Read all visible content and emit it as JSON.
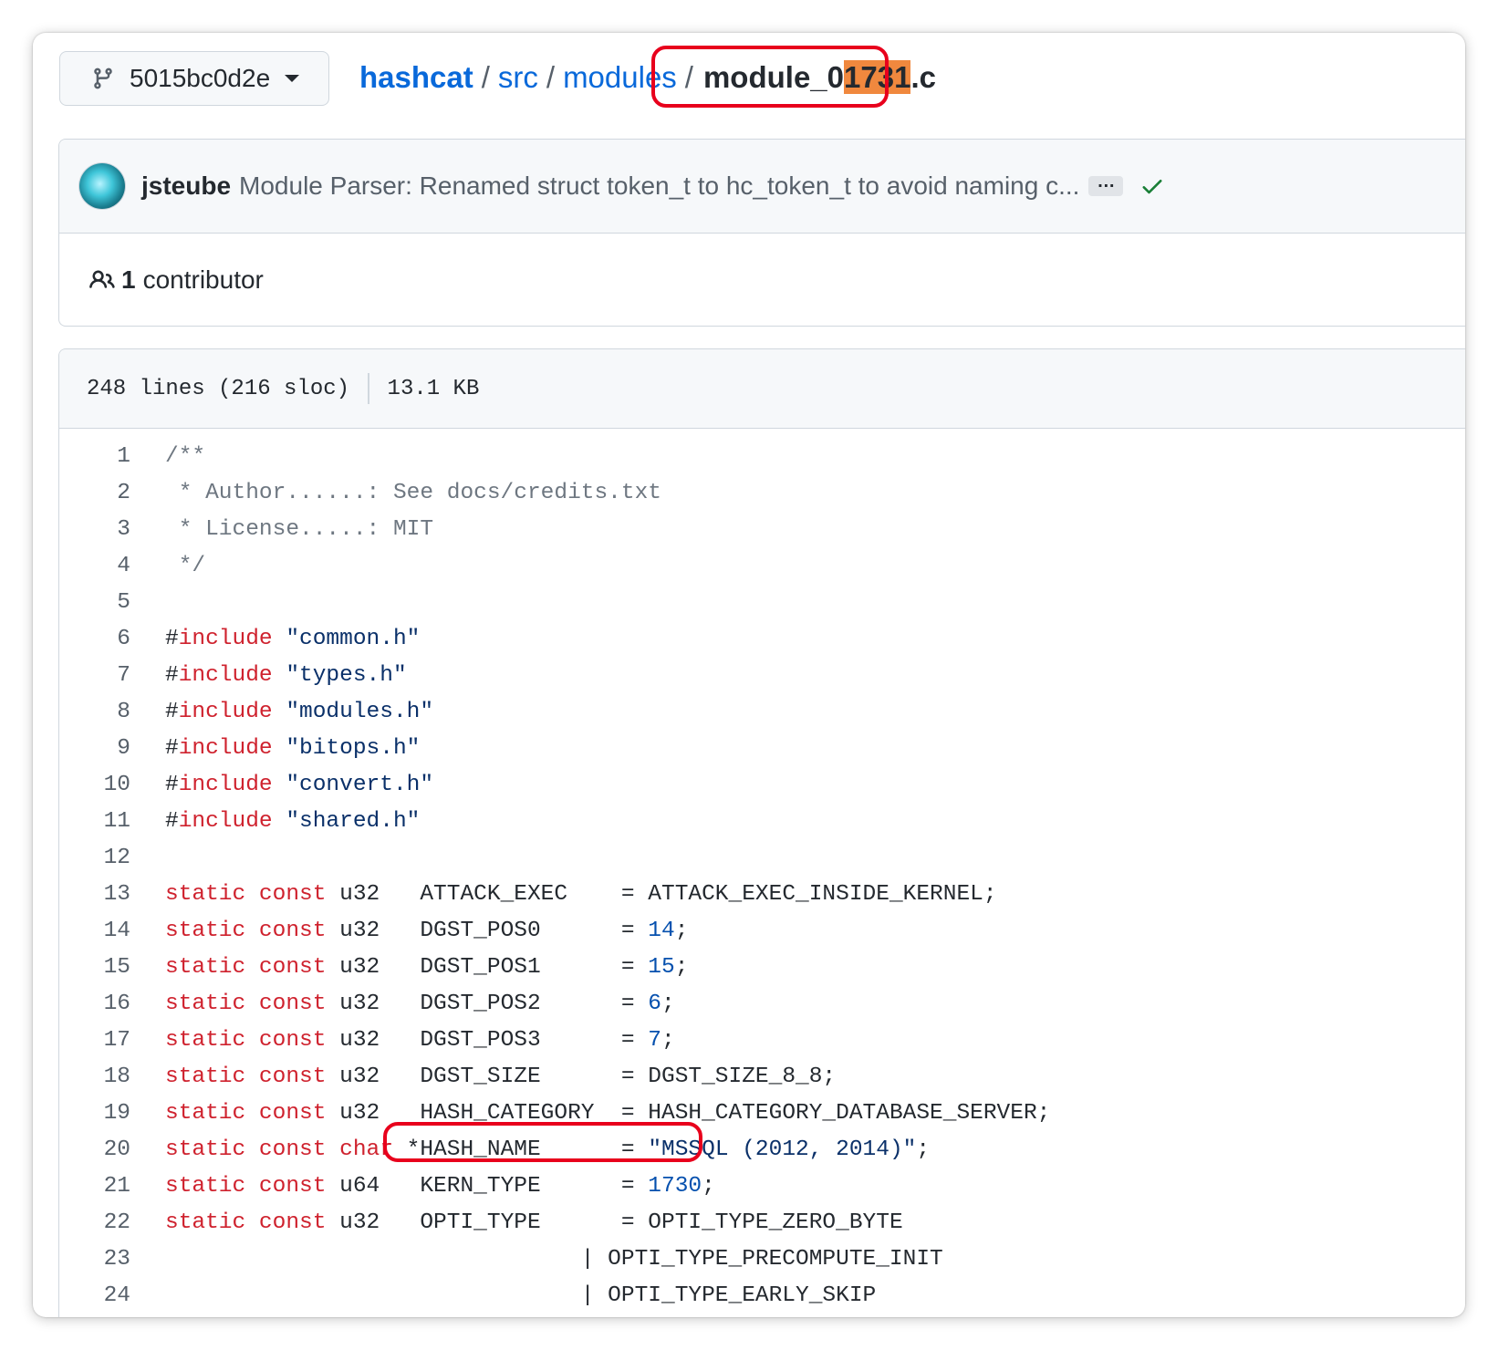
{
  "breadcrumb": {
    "branch": "5015bc0d2e",
    "repo": "hashcat",
    "path1": "src",
    "path2": "modules",
    "separator": "/",
    "file_prefix": "module_0",
    "file_highlight": "1731",
    "file_suffix": ".c"
  },
  "commit": {
    "author": "jsteube",
    "message": "Module Parser: Renamed struct token_t to hc_token_t to avoid naming c...",
    "ellipsis": "…"
  },
  "contributors": {
    "count": "1",
    "label": "contributor"
  },
  "file_info": {
    "lines": "248 lines (216 sloc)",
    "size": "13.1 KB"
  },
  "code_lines": [
    {
      "n": "1",
      "t": [
        [
          "c",
          "/**"
        ]
      ]
    },
    {
      "n": "2",
      "t": [
        [
          "c",
          " * Author......: See docs/credits.txt"
        ]
      ]
    },
    {
      "n": "3",
      "t": [
        [
          "c",
          " * License.....: MIT"
        ]
      ]
    },
    {
      "n": "4",
      "t": [
        [
          "c",
          " */"
        ]
      ]
    },
    {
      "n": "5",
      "t": []
    },
    {
      "n": "6",
      "t": [
        [
          "p",
          "#"
        ],
        [
          "k",
          "include"
        ],
        [
          "p",
          " "
        ],
        [
          "s",
          "\"common.h\""
        ]
      ]
    },
    {
      "n": "7",
      "t": [
        [
          "p",
          "#"
        ],
        [
          "k",
          "include"
        ],
        [
          "p",
          " "
        ],
        [
          "s",
          "\"types.h\""
        ]
      ]
    },
    {
      "n": "8",
      "t": [
        [
          "p",
          "#"
        ],
        [
          "k",
          "include"
        ],
        [
          "p",
          " "
        ],
        [
          "s",
          "\"modules.h\""
        ]
      ]
    },
    {
      "n": "9",
      "t": [
        [
          "p",
          "#"
        ],
        [
          "k",
          "include"
        ],
        [
          "p",
          " "
        ],
        [
          "s",
          "\"bitops.h\""
        ]
      ]
    },
    {
      "n": "10",
      "t": [
        [
          "p",
          "#"
        ],
        [
          "k",
          "include"
        ],
        [
          "p",
          " "
        ],
        [
          "s",
          "\"convert.h\""
        ]
      ]
    },
    {
      "n": "11",
      "t": [
        [
          "p",
          "#"
        ],
        [
          "k",
          "include"
        ],
        [
          "p",
          " "
        ],
        [
          "s",
          "\"shared.h\""
        ]
      ]
    },
    {
      "n": "12",
      "t": []
    },
    {
      "n": "13",
      "t": [
        [
          "k",
          "static"
        ],
        [
          "p",
          " "
        ],
        [
          "k",
          "const"
        ],
        [
          "p",
          " u32   ATTACK_EXEC    = ATTACK_EXEC_INSIDE_KERNEL;"
        ]
      ]
    },
    {
      "n": "14",
      "t": [
        [
          "k",
          "static"
        ],
        [
          "p",
          " "
        ],
        [
          "k",
          "const"
        ],
        [
          "p",
          " u32   DGST_POS0      = "
        ],
        [
          "n",
          "14"
        ],
        [
          "p",
          ";"
        ]
      ]
    },
    {
      "n": "15",
      "t": [
        [
          "k",
          "static"
        ],
        [
          "p",
          " "
        ],
        [
          "k",
          "const"
        ],
        [
          "p",
          " u32   DGST_POS1      = "
        ],
        [
          "n",
          "15"
        ],
        [
          "p",
          ";"
        ]
      ]
    },
    {
      "n": "16",
      "t": [
        [
          "k",
          "static"
        ],
        [
          "p",
          " "
        ],
        [
          "k",
          "const"
        ],
        [
          "p",
          " u32   DGST_POS2      = "
        ],
        [
          "n",
          "6"
        ],
        [
          "p",
          ";"
        ]
      ]
    },
    {
      "n": "17",
      "t": [
        [
          "k",
          "static"
        ],
        [
          "p",
          " "
        ],
        [
          "k",
          "const"
        ],
        [
          "p",
          " u32   DGST_POS3      = "
        ],
        [
          "n",
          "7"
        ],
        [
          "p",
          ";"
        ]
      ]
    },
    {
      "n": "18",
      "t": [
        [
          "k",
          "static"
        ],
        [
          "p",
          " "
        ],
        [
          "k",
          "const"
        ],
        [
          "p",
          " u32   DGST_SIZE      = DGST_SIZE_8_8;"
        ]
      ]
    },
    {
      "n": "19",
      "t": [
        [
          "k",
          "static"
        ],
        [
          "p",
          " "
        ],
        [
          "k",
          "const"
        ],
        [
          "p",
          " u32   HASH_CATEGORY  = HASH_CATEGORY_DATABASE_SERVER;"
        ]
      ]
    },
    {
      "n": "20",
      "t": [
        [
          "k",
          "static"
        ],
        [
          "p",
          " "
        ],
        [
          "k",
          "const"
        ],
        [
          "p",
          " "
        ],
        [
          "k",
          "char"
        ],
        [
          "p",
          " *HASH_NAME      = "
        ],
        [
          "s",
          "\"MSSQL (2012, 2014)\""
        ],
        [
          "p",
          ";"
        ]
      ]
    },
    {
      "n": "21",
      "t": [
        [
          "k",
          "static"
        ],
        [
          "p",
          " "
        ],
        [
          "k",
          "const"
        ],
        [
          "p",
          " u64   KERN_TYPE      = "
        ],
        [
          "n",
          "1730"
        ],
        [
          "p",
          ";"
        ]
      ]
    },
    {
      "n": "22",
      "t": [
        [
          "k",
          "static"
        ],
        [
          "p",
          " "
        ],
        [
          "k",
          "const"
        ],
        [
          "p",
          " u32   OPTI_TYPE      = OPTI_TYPE_ZERO_BYTE"
        ]
      ]
    },
    {
      "n": "23",
      "t": [
        [
          "p",
          "                               | OPTI_TYPE_PRECOMPUTE_INIT"
        ]
      ]
    },
    {
      "n": "24",
      "t": [
        [
          "p",
          "                               | OPTI_TYPE_EARLY_SKIP"
        ]
      ]
    }
  ],
  "colors": {
    "link": "#0969da",
    "keyword": "#cf222e",
    "string": "#0a3069",
    "number": "#0550ae",
    "highlight": "#f0883e",
    "annotation": "#e8001c",
    "check": "#1a7f37"
  }
}
